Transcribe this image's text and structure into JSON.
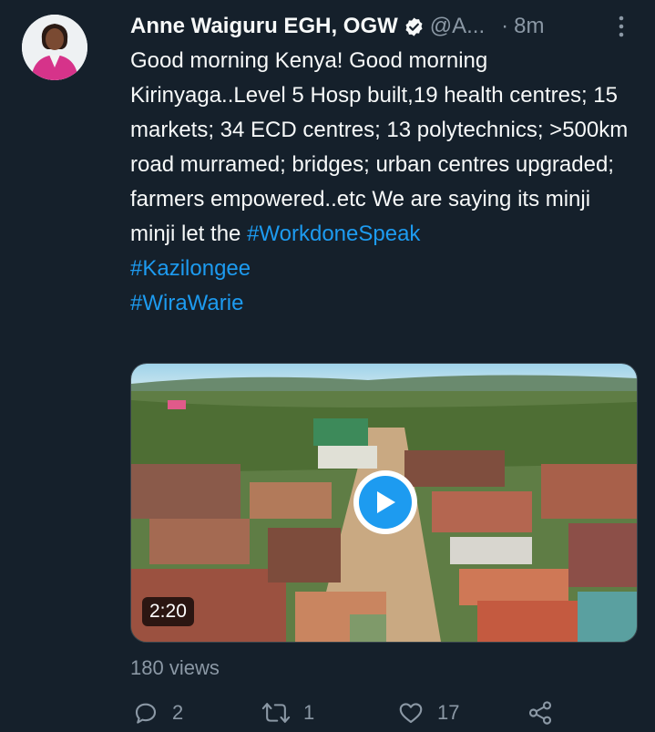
{
  "tweet": {
    "author_name": "Anne Waiguru EGH, OGW",
    "handle": "@A...",
    "separator": "·",
    "time": "8m",
    "text_intro": "Good morning Kenya! Good morning Kirinyaga..Level 5 Hosp built,19 health centres; 15 markets; 34 ECD centres; 13 polytechnics; >500km road murramed; bridges; urban centres upgraded; farmers empowered..etc We are saying its minji minji let the ",
    "hashtags": [
      "#WorkdoneSpeak",
      "#Kazilongee",
      "#WiraWarie"
    ],
    "video_duration": "2:20",
    "views": "180 views"
  },
  "actions": {
    "reply_count": "2",
    "retweet_count": "1",
    "like_count": "17"
  },
  "icons": {
    "verified": "verified-badge-icon",
    "more": "more-vertical-icon",
    "play": "play-icon",
    "reply": "reply-icon",
    "retweet": "retweet-icon",
    "like": "heart-icon",
    "share": "share-icon"
  },
  "colors": {
    "background": "#15202b",
    "text": "#f7f9f9",
    "secondary": "#8b98a5",
    "link": "#1d9bf0"
  }
}
